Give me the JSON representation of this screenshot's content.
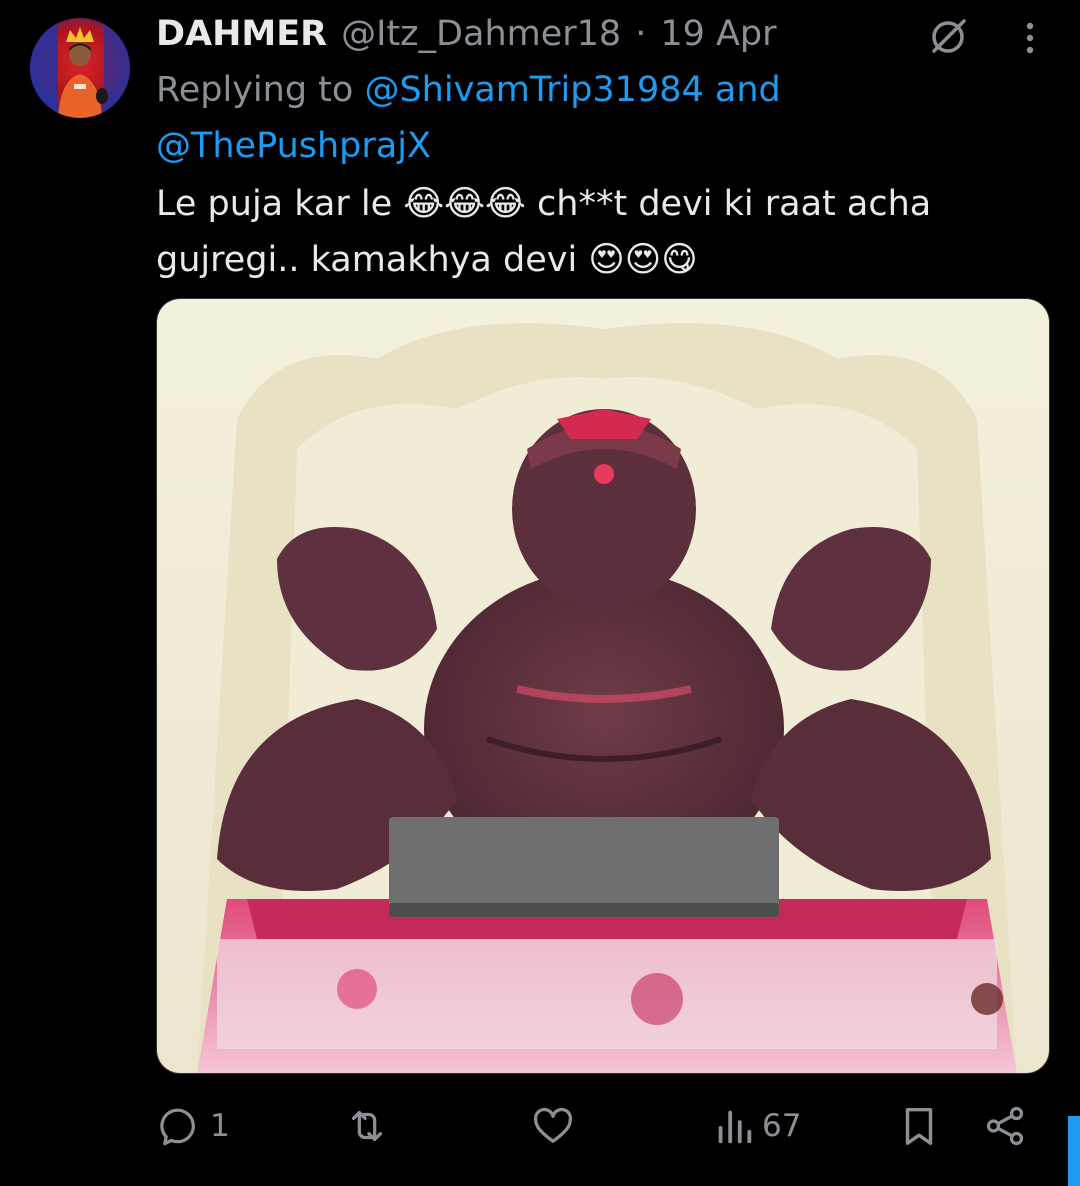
{
  "tweet": {
    "display_name": "DAHMER",
    "handle": "@Itz_Dahmer18",
    "separator": "·",
    "timestamp": "19 Apr",
    "reply_prefix": "Replying to",
    "reply_mention_1": "@ShivamTrip31984",
    "reply_and": "and",
    "reply_mention_2": "@ThePushprajX",
    "text": "Le puja kar le 😂😂😂 ch**t devi ki raat acha gujregi.. kamakhya devi 😍😍😋"
  },
  "actions": {
    "reply_count": "1",
    "retweet_count": "",
    "like_count": "",
    "views_count": "67"
  },
  "icons": {
    "grok": "grok-icon",
    "more": "more-vertical-icon",
    "reply": "reply-icon",
    "retweet": "retweet-icon",
    "like": "heart-icon",
    "views": "views-icon",
    "bookmark": "bookmark-icon",
    "share": "share-icon"
  },
  "colors": {
    "background": "#000000",
    "text_primary": "#e7e9ea",
    "text_secondary": "#8b9096",
    "accent": "#1d9bf0"
  }
}
